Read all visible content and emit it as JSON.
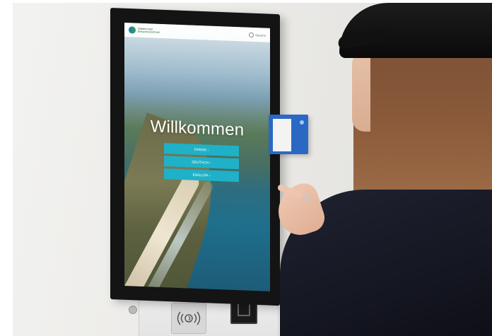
{
  "kiosk": {
    "brand": {
      "name": "Wattenmeer Besucherzentrum"
    },
    "language_menu_label": "Sprache",
    "welcome_text": "Willkommen",
    "language_buttons": [
      {
        "label": "DANSK  ›"
      },
      {
        "label": "DEUTSCH  ›"
      },
      {
        "label": "ENGLISH  ›"
      }
    ]
  },
  "colors": {
    "accent": "#1fb1c8",
    "box_holder": "#2a68c4",
    "bezel": "#141414"
  },
  "icons": {
    "nfc": "contactless-icon",
    "globe": "globe-icon"
  }
}
